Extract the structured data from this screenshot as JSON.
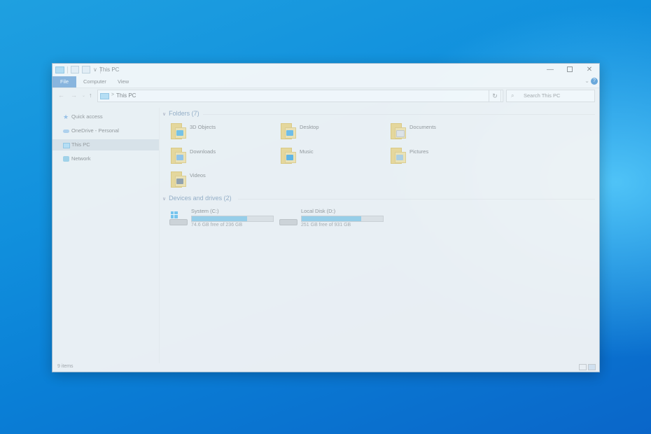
{
  "window": {
    "title": "This PC",
    "controls": {
      "minimize": "—",
      "maximize": "",
      "close": "✕"
    }
  },
  "ribbon": {
    "tabs": [
      "File",
      "Computer",
      "View"
    ],
    "collapse": "⌄",
    "help": "?"
  },
  "address": {
    "path": "This PC",
    "separator": ">",
    "dropdown": "⌄",
    "refresh": "↻"
  },
  "search": {
    "placeholder": "Search This PC",
    "icon": "⌕"
  },
  "nav": {
    "back": "←",
    "forward": "→",
    "recent": "⌄",
    "up": "↑",
    "items": [
      {
        "label": "Quick access",
        "icon": "star-icon"
      },
      {
        "label": "OneDrive - Personal",
        "icon": "cloud-icon"
      },
      {
        "label": "This PC",
        "icon": "computer-icon",
        "selected": true
      },
      {
        "label": "Network",
        "icon": "network-icon"
      }
    ]
  },
  "folders_group": {
    "header": "Folders (7)",
    "items": [
      {
        "label": "3D Objects",
        "icon": "3d-objects-folder-icon",
        "accent": "#7cc6e8"
      },
      {
        "label": "Desktop",
        "icon": "desktop-folder-icon",
        "accent": "#74c0ea"
      },
      {
        "label": "Documents",
        "icon": "documents-folder-icon",
        "accent": "#e9e9e9"
      },
      {
        "label": "Downloads",
        "icon": "downloads-folder-icon",
        "accent": "#9ac8ea"
      },
      {
        "label": "Music",
        "icon": "music-folder-icon",
        "accent": "#66b8e6"
      },
      {
        "label": "Pictures",
        "icon": "pictures-folder-icon",
        "accent": "#b7d3e3"
      },
      {
        "label": "Videos",
        "icon": "videos-folder-icon",
        "accent": "#9aa4ad"
      }
    ]
  },
  "drives_group": {
    "header": "Devices and drives (2)",
    "items": [
      {
        "label": "System (C:)",
        "free": "74.6 GB free of 236 GB",
        "used_fraction": 0.68,
        "windows": true
      },
      {
        "label": "Local Disk (D:)",
        "free": "251 GB free of 931 GB",
        "used_fraction": 0.73,
        "windows": false
      }
    ]
  },
  "status": {
    "count": "9 items"
  }
}
